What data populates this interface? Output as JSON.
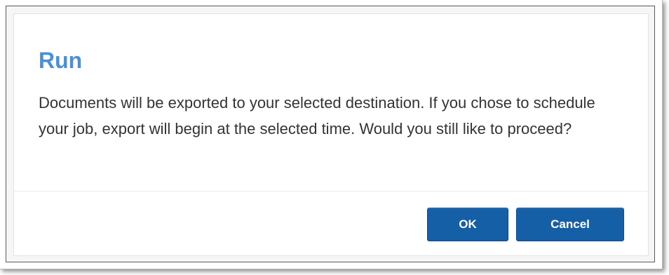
{
  "dialog": {
    "title": "Run",
    "message": "Documents will be exported to your selected destination. If you chose to schedule your job, export will begin at the selected time. Would you still like to proceed?",
    "ok_label": "OK",
    "cancel_label": "Cancel"
  },
  "colors": {
    "title": "#4a90d9",
    "button": "#155fa6",
    "text": "#333333"
  }
}
